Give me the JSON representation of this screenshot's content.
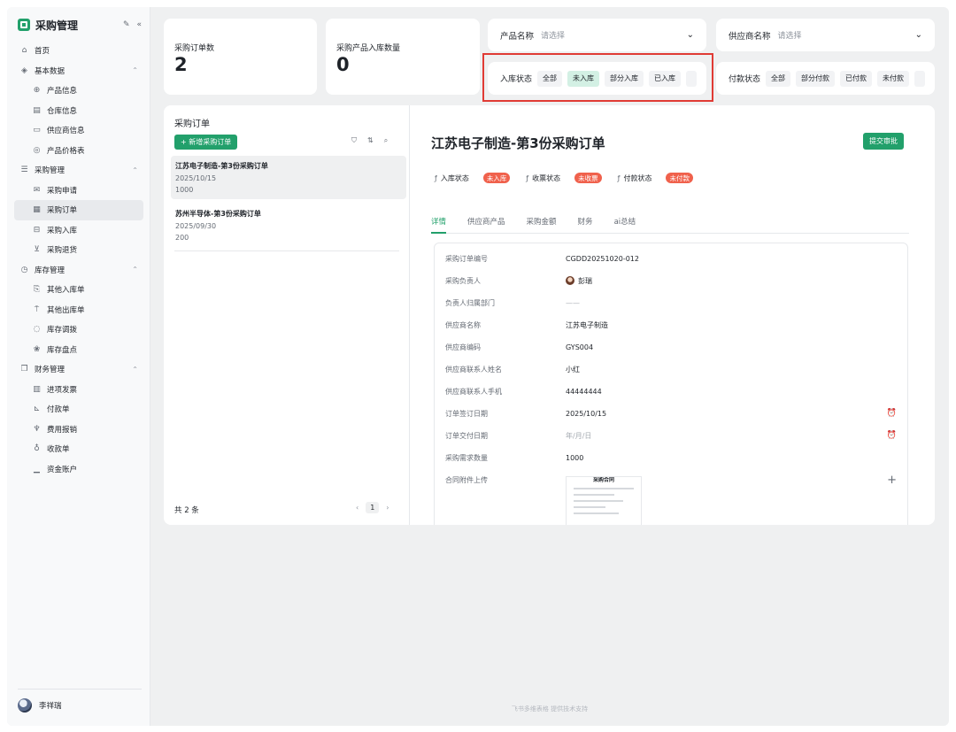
{
  "app": {
    "title": "采购管理",
    "edit_icon": "edit-icon",
    "collapse_icon": "collapse-icon"
  },
  "sidebar": {
    "items": [
      {
        "label": "首页",
        "icon": "home-icon",
        "level": 0
      },
      {
        "label": "基本数据",
        "icon": "layers-icon",
        "level": 0,
        "group": true
      },
      {
        "label": "产品信息",
        "icon": "globe-icon",
        "level": 1
      },
      {
        "label": "仓库信息",
        "icon": "warehouse-icon",
        "level": 1
      },
      {
        "label": "供应商信息",
        "icon": "monitor-icon",
        "level": 1
      },
      {
        "label": "产品价格表",
        "icon": "price-icon",
        "level": 1
      },
      {
        "label": "采购管理",
        "icon": "list-icon",
        "level": 0,
        "group": true
      },
      {
        "label": "采购申请",
        "icon": "mail-icon",
        "level": 1
      },
      {
        "label": "采购订单",
        "icon": "calendar-icon",
        "level": 1,
        "active": true
      },
      {
        "label": "采购入库",
        "icon": "inbox-icon",
        "level": 1
      },
      {
        "label": "采购退货",
        "icon": "return-icon",
        "level": 1
      },
      {
        "label": "库存管理",
        "icon": "clock-icon",
        "level": 0,
        "group": true
      },
      {
        "label": "其他入库单",
        "icon": "doc-in-icon",
        "level": 1
      },
      {
        "label": "其他出库单",
        "icon": "doc-out-icon",
        "level": 1
      },
      {
        "label": "库存调拨",
        "icon": "transfer-icon",
        "level": 1
      },
      {
        "label": "库存盘点",
        "icon": "count-icon",
        "level": 1
      },
      {
        "label": "财务管理",
        "icon": "copy-icon",
        "level": 0,
        "group": true
      },
      {
        "label": "进项发票",
        "icon": "barcode-icon",
        "level": 1
      },
      {
        "label": "付款单",
        "icon": "chart-line-icon",
        "level": 1
      },
      {
        "label": "费用报销",
        "icon": "trophy-icon",
        "level": 1
      },
      {
        "label": "收款单",
        "icon": "bulb-icon",
        "level": 1
      },
      {
        "label": "资金账户",
        "icon": "bar-chart-icon",
        "level": 1
      }
    ],
    "user": "李祥瑞"
  },
  "stats": {
    "orders_label": "采购订单数",
    "orders_value": "2",
    "inbound_label": "采购产品入库数量",
    "inbound_value": "0"
  },
  "filters": {
    "product_label": "产品名称",
    "product_placeholder": "请选择",
    "supplier_label": "供应商名称",
    "supplier_placeholder": "请选择",
    "inbound_status": {
      "title": "入库状态",
      "options": [
        "全部",
        "未入库",
        "部分入库",
        "已入库"
      ],
      "selected": "未入库"
    },
    "payment_status": {
      "title": "付款状态",
      "options": [
        "全部",
        "部分付款",
        "已付款",
        "未付款"
      ]
    },
    "highlight_color": "#e03b35"
  },
  "list": {
    "title": "采购订单",
    "add_label": "+ 新增采购订单",
    "orders": [
      {
        "title": "江苏电子制造-第3份采购订单",
        "date": "2025/10/15",
        "qty": "1000"
      },
      {
        "title": "苏州半导体-第3份采购订单",
        "date": "2025/09/30",
        "qty": "200"
      }
    ],
    "total": "共 2 条",
    "page": "1"
  },
  "detail": {
    "title": "江苏电子制造-第3份采购订单",
    "submit_label": "提交审批",
    "statuses": [
      {
        "name": "入库状态",
        "value": "未入库"
      },
      {
        "name": "收票状态",
        "value": "未收票"
      },
      {
        "name": "付款状态",
        "value": "未付款"
      }
    ],
    "tabs": [
      "详情",
      "供应商产品",
      "采购金额",
      "财务",
      "ai总结"
    ],
    "fields": [
      {
        "label": "采购订单编号",
        "value": "CGDD20251020-012"
      },
      {
        "label": "采购负责人",
        "value": "彭瑞"
      },
      {
        "label": "负责人归属部门",
        "value": "——"
      },
      {
        "label": "供应商名称",
        "value": "江苏电子制造"
      },
      {
        "label": "供应商编码",
        "value": "GYS004"
      },
      {
        "label": "供应商联系人姓名",
        "value": "小红"
      },
      {
        "label": "供应商联系人手机",
        "value": "44444444"
      },
      {
        "label": "订单签订日期",
        "value": "2025/10/15"
      },
      {
        "label": "订单交付日期",
        "value": "年/月/日"
      },
      {
        "label": "采购需求数量",
        "value": "1000"
      },
      {
        "label": "合同附件上传",
        "value": ""
      }
    ],
    "attachment_heading": "采购合同"
  },
  "footer": "飞书多维表格 提供技术支持",
  "colors": {
    "accent": "#22a06b",
    "danger": "#f0614c"
  }
}
